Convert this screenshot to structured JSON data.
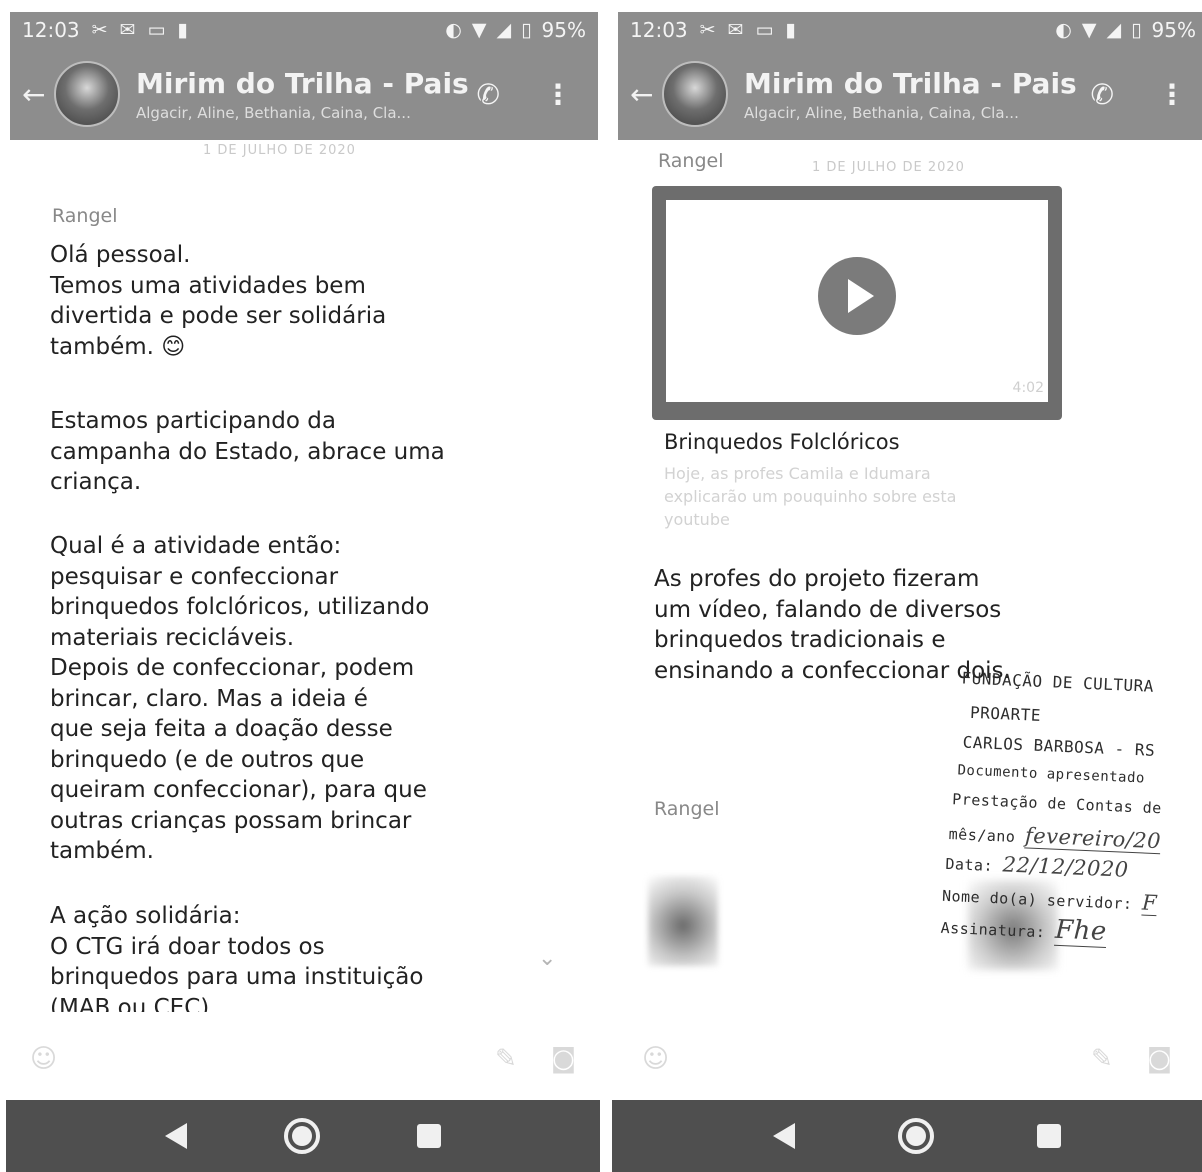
{
  "status_bar": {
    "time": "12:03",
    "battery": "95%",
    "icons": [
      "tools-icon",
      "mail-icon",
      "cast-icon",
      "notes-icon",
      "data-saver-icon",
      "wifi-icon",
      "signal-icon",
      "battery-icon"
    ]
  },
  "chat": {
    "title": "Mirim do Trilha - Pais",
    "subtitle": "Algacir, Aline, Bethania, Caina, Cla..."
  },
  "left": {
    "date_chip": "1 DE JULHO DE 2020",
    "sender": "Rangel",
    "message_1": "Olá pessoal.\nTemos uma atividades bem\ndivertida e pode ser solidária\ntambém. 😊",
    "message_2": "Estamos participando da\ncampanha do Estado, abrace uma\ncriança.",
    "message_3": "Qual é a atividade então:\npesquisar e confeccionar\nbrinquedos folclóricos, utilizando\nmateriais recicláveis.\nDepois de confeccionar, podem\nbrincar, claro. Mas a ideia é\nque seja feita a doação desse\nbrinquedo (e de outros que\nqueiram confeccionar), para que\noutras crianças possam brincar\ntambém.",
    "message_4": "A ação solidária:\nO CTG irá doar todos os\nbrinquedos para uma instituição\n(MAB ou CEC)"
  },
  "right": {
    "date_chip": "1 DE JULHO DE 2020",
    "sender_1": "Rangel",
    "video_duration": "4:02",
    "link_title": "Brinquedos Folclóricos",
    "link_description": "Hoje, as profes Camila e Idumara\nexplicarão um pouquinho sobre esta\nyoutube",
    "message": "As profes do projeto fizeram\num vídeo, falando de diversos\nbrinquedos tradicionais e\nensinando a confeccionar dois.",
    "sender_2": "Rangel"
  },
  "stamp": {
    "line_1": "FUNDAÇÃO DE CULTURA",
    "line_2": "PROARTE",
    "line_3": "CARLOS BARBOSA - RS",
    "line_4": "Documento apresentado",
    "line_5": "Prestação de Contas de",
    "line_6_label": "mês/ano",
    "line_6_value": "fevereiro/20",
    "line_7_label": "Data:",
    "line_7_value": "22/12/2020",
    "line_8_label": "Nome do(a) servidor:",
    "line_8_value": "F",
    "line_9_label": "Assinatura:",
    "line_9_value": "Fhe"
  },
  "colors": {
    "app_bar": "#8d8d8d",
    "nav_bar": "#4f4f4f",
    "sender": "#888888",
    "message_text": "#222222"
  }
}
